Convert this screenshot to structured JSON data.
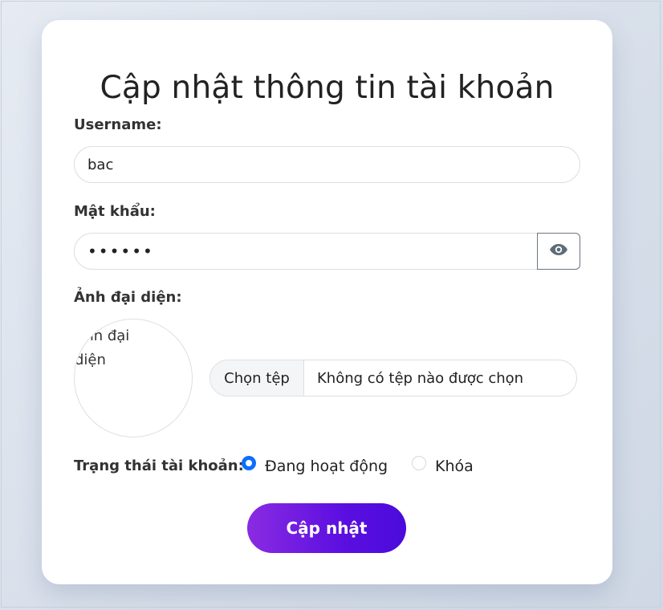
{
  "form": {
    "title": "Cập nhật thông tin tài khoản",
    "username_label": "Username:",
    "username_value": "bac",
    "password_label": "Mật khẩu:",
    "password_value": "••••••",
    "avatar_label": "Ảnh đại diện:",
    "avatar_alt": "Ảnh đại diện",
    "file_button": "Chọn tệp",
    "file_status": "Không có tệp nào được chọn",
    "status_label": "Trạng thái tài khoản:",
    "status_options": [
      {
        "label": "Đang hoạt động",
        "checked": true
      },
      {
        "label": "Khóa",
        "checked": false
      }
    ],
    "submit_label": "Cập nhật"
  },
  "icons": {
    "password_toggle": "eye-icon"
  },
  "colors": {
    "primary_gradient_start": "#8a2be2",
    "primary_gradient_end": "#4b0bdc",
    "radio_checked": "#0d6efd"
  }
}
